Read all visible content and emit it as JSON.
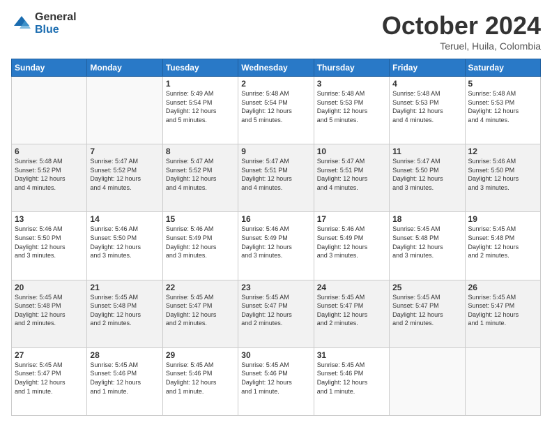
{
  "logo": {
    "general": "General",
    "blue": "Blue"
  },
  "header": {
    "title": "October 2024",
    "location": "Teruel, Huila, Colombia"
  },
  "weekdays": [
    "Sunday",
    "Monday",
    "Tuesday",
    "Wednesday",
    "Thursday",
    "Friday",
    "Saturday"
  ],
  "weeks": [
    [
      {
        "day": "",
        "info": ""
      },
      {
        "day": "",
        "info": ""
      },
      {
        "day": "1",
        "info": "Sunrise: 5:49 AM\nSunset: 5:54 PM\nDaylight: 12 hours\nand 5 minutes."
      },
      {
        "day": "2",
        "info": "Sunrise: 5:48 AM\nSunset: 5:54 PM\nDaylight: 12 hours\nand 5 minutes."
      },
      {
        "day": "3",
        "info": "Sunrise: 5:48 AM\nSunset: 5:53 PM\nDaylight: 12 hours\nand 5 minutes."
      },
      {
        "day": "4",
        "info": "Sunrise: 5:48 AM\nSunset: 5:53 PM\nDaylight: 12 hours\nand 4 minutes."
      },
      {
        "day": "5",
        "info": "Sunrise: 5:48 AM\nSunset: 5:53 PM\nDaylight: 12 hours\nand 4 minutes."
      }
    ],
    [
      {
        "day": "6",
        "info": "Sunrise: 5:48 AM\nSunset: 5:52 PM\nDaylight: 12 hours\nand 4 minutes."
      },
      {
        "day": "7",
        "info": "Sunrise: 5:47 AM\nSunset: 5:52 PM\nDaylight: 12 hours\nand 4 minutes."
      },
      {
        "day": "8",
        "info": "Sunrise: 5:47 AM\nSunset: 5:52 PM\nDaylight: 12 hours\nand 4 minutes."
      },
      {
        "day": "9",
        "info": "Sunrise: 5:47 AM\nSunset: 5:51 PM\nDaylight: 12 hours\nand 4 minutes."
      },
      {
        "day": "10",
        "info": "Sunrise: 5:47 AM\nSunset: 5:51 PM\nDaylight: 12 hours\nand 4 minutes."
      },
      {
        "day": "11",
        "info": "Sunrise: 5:47 AM\nSunset: 5:50 PM\nDaylight: 12 hours\nand 3 minutes."
      },
      {
        "day": "12",
        "info": "Sunrise: 5:46 AM\nSunset: 5:50 PM\nDaylight: 12 hours\nand 3 minutes."
      }
    ],
    [
      {
        "day": "13",
        "info": "Sunrise: 5:46 AM\nSunset: 5:50 PM\nDaylight: 12 hours\nand 3 minutes."
      },
      {
        "day": "14",
        "info": "Sunrise: 5:46 AM\nSunset: 5:50 PM\nDaylight: 12 hours\nand 3 minutes."
      },
      {
        "day": "15",
        "info": "Sunrise: 5:46 AM\nSunset: 5:49 PM\nDaylight: 12 hours\nand 3 minutes."
      },
      {
        "day": "16",
        "info": "Sunrise: 5:46 AM\nSunset: 5:49 PM\nDaylight: 12 hours\nand 3 minutes."
      },
      {
        "day": "17",
        "info": "Sunrise: 5:46 AM\nSunset: 5:49 PM\nDaylight: 12 hours\nand 3 minutes."
      },
      {
        "day": "18",
        "info": "Sunrise: 5:45 AM\nSunset: 5:48 PM\nDaylight: 12 hours\nand 3 minutes."
      },
      {
        "day": "19",
        "info": "Sunrise: 5:45 AM\nSunset: 5:48 PM\nDaylight: 12 hours\nand 2 minutes."
      }
    ],
    [
      {
        "day": "20",
        "info": "Sunrise: 5:45 AM\nSunset: 5:48 PM\nDaylight: 12 hours\nand 2 minutes."
      },
      {
        "day": "21",
        "info": "Sunrise: 5:45 AM\nSunset: 5:48 PM\nDaylight: 12 hours\nand 2 minutes."
      },
      {
        "day": "22",
        "info": "Sunrise: 5:45 AM\nSunset: 5:47 PM\nDaylight: 12 hours\nand 2 minutes."
      },
      {
        "day": "23",
        "info": "Sunrise: 5:45 AM\nSunset: 5:47 PM\nDaylight: 12 hours\nand 2 minutes."
      },
      {
        "day": "24",
        "info": "Sunrise: 5:45 AM\nSunset: 5:47 PM\nDaylight: 12 hours\nand 2 minutes."
      },
      {
        "day": "25",
        "info": "Sunrise: 5:45 AM\nSunset: 5:47 PM\nDaylight: 12 hours\nand 2 minutes."
      },
      {
        "day": "26",
        "info": "Sunrise: 5:45 AM\nSunset: 5:47 PM\nDaylight: 12 hours\nand 1 minute."
      }
    ],
    [
      {
        "day": "27",
        "info": "Sunrise: 5:45 AM\nSunset: 5:47 PM\nDaylight: 12 hours\nand 1 minute."
      },
      {
        "day": "28",
        "info": "Sunrise: 5:45 AM\nSunset: 5:46 PM\nDaylight: 12 hours\nand 1 minute."
      },
      {
        "day": "29",
        "info": "Sunrise: 5:45 AM\nSunset: 5:46 PM\nDaylight: 12 hours\nand 1 minute."
      },
      {
        "day": "30",
        "info": "Sunrise: 5:45 AM\nSunset: 5:46 PM\nDaylight: 12 hours\nand 1 minute."
      },
      {
        "day": "31",
        "info": "Sunrise: 5:45 AM\nSunset: 5:46 PM\nDaylight: 12 hours\nand 1 minute."
      },
      {
        "day": "",
        "info": ""
      },
      {
        "day": "",
        "info": ""
      }
    ]
  ]
}
